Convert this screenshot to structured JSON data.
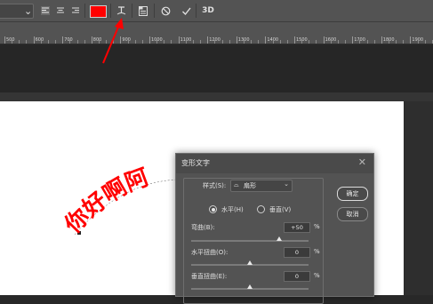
{
  "toolbar": {
    "buttons": [
      {
        "name": "align-left-icon"
      },
      {
        "name": "align-center-icon"
      },
      {
        "name": "align-right-icon"
      },
      {
        "name": "text-color-swatch",
        "color": "#ff0000"
      },
      {
        "name": "warp-text-icon"
      },
      {
        "name": "character-panel-icon"
      },
      {
        "name": "cancel-icon"
      },
      {
        "name": "commit-icon"
      },
      {
        "name": "3d-icon"
      }
    ],
    "btn_3d_label": "3D"
  },
  "ruler": {
    "ticks": [
      "500",
      "600",
      "700",
      "800",
      "900",
      "1000",
      "1100",
      "1200",
      "1300",
      "1400",
      "1500",
      "1600",
      "1700",
      "1800",
      "1900"
    ]
  },
  "canvas": {
    "text": "你好啊阿",
    "text_color": "#ff0000"
  },
  "dialog": {
    "title": "变形文字",
    "style_label": "样式(S):",
    "style_value": "扇形",
    "horizontal_label": "水平(H)",
    "vertical_label": "垂直(V)",
    "bend_label": "弯曲(B):",
    "bend_value": "+50",
    "bend_level": 0.75,
    "h_distort_label": "水平扭曲(O):",
    "h_distort_value": "0",
    "h_distort_level": 0.5,
    "v_distort_label": "垂直扭曲(E):",
    "v_distort_value": "0",
    "v_distort_level": 0.5,
    "percent": "%",
    "ok_label": "确定",
    "cancel_label": "取消"
  }
}
